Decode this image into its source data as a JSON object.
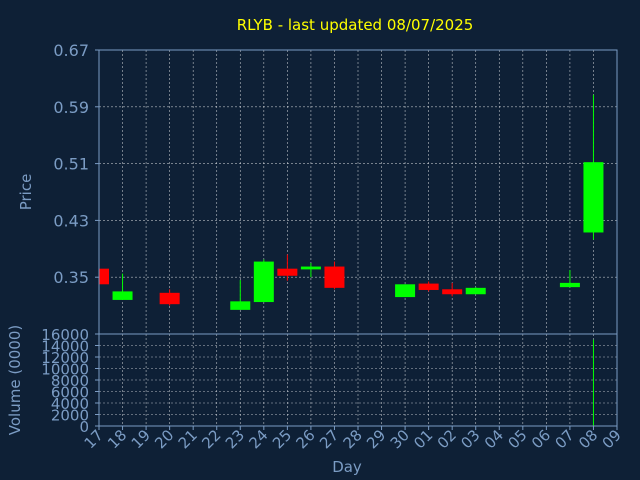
{
  "chart_data": {
    "type": "candlestick",
    "title": "RLYB - last updated 08/07/2025",
    "xlabel": "Day",
    "ylabel": "Price",
    "volume_label": "Volume (0000)",
    "x_ticks": [
      "17",
      "18",
      "19",
      "20",
      "21",
      "22",
      "23",
      "24",
      "25",
      "26",
      "27",
      "28",
      "29",
      "30",
      "01",
      "02",
      "03",
      "04",
      "05",
      "06",
      "07",
      "08",
      "09"
    ],
    "price_ticks": [
      "0.35",
      "0.43",
      "0.51",
      "0.59",
      "0.67"
    ],
    "price_range": [
      0.27,
      0.67
    ],
    "volume_ticks": [
      "0",
      "2000",
      "4000",
      "6000",
      "8000",
      "10000",
      "12000",
      "14000",
      "16000"
    ],
    "volume_range": [
      0,
      16000
    ],
    "grid": true,
    "colors": {
      "background": "#0e2036",
      "up": "#00ff00",
      "down": "#ff0000",
      "axis": "#7b9cc4",
      "title": "#ffff00",
      "grid": "#ffffff"
    },
    "candles": [
      {
        "day": "17",
        "open": 0.362,
        "high": 0.362,
        "low": 0.34,
        "close": 0.34
      },
      {
        "day": "18",
        "open": 0.318,
        "high": 0.355,
        "low": 0.318,
        "close": 0.33
      },
      {
        "day": "20",
        "open": 0.328,
        "high": 0.333,
        "low": 0.31,
        "close": 0.312
      },
      {
        "day": "23",
        "open": 0.304,
        "high": 0.346,
        "low": 0.304,
        "close": 0.316
      },
      {
        "day": "24",
        "open": 0.315,
        "high": 0.375,
        "low": 0.315,
        "close": 0.372
      },
      {
        "day": "25",
        "open": 0.362,
        "high": 0.382,
        "low": 0.345,
        "close": 0.352
      },
      {
        "day": "26",
        "open": 0.361,
        "high": 0.37,
        "low": 0.35,
        "close": 0.365
      },
      {
        "day": "27",
        "open": 0.365,
        "high": 0.372,
        "low": 0.333,
        "close": 0.335
      },
      {
        "day": "30",
        "open": 0.322,
        "high": 0.34,
        "low": 0.322,
        "close": 0.34
      },
      {
        "day": "01",
        "open": 0.341,
        "high": 0.344,
        "low": 0.33,
        "close": 0.332
      },
      {
        "day": "02",
        "open": 0.333,
        "high": 0.342,
        "low": 0.323,
        "close": 0.326
      },
      {
        "day": "03",
        "open": 0.326,
        "high": 0.336,
        "low": 0.326,
        "close": 0.335
      },
      {
        "day": "07",
        "open": 0.336,
        "high": 0.36,
        "low": 0.336,
        "close": 0.342
      },
      {
        "day": "08",
        "open": 0.413,
        "high": 0.607,
        "low": 0.403,
        "close": 0.512
      }
    ],
    "volume": [
      {
        "day": "08",
        "value": 15000
      }
    ]
  }
}
